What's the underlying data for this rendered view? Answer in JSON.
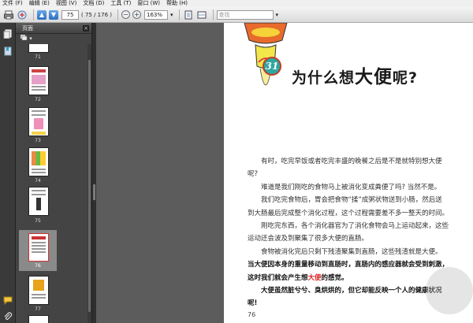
{
  "menu": [
    "文件 (F)",
    "编辑 (E)",
    "视图 (V)",
    "文档 (D)",
    "工具 (T)",
    "窗口 (W)",
    "帮助 (H)"
  ],
  "toolbar": {
    "page_current": "75",
    "page_total": "( 75 / 176 )",
    "zoom": "163%",
    "search_placeholder": "查找"
  },
  "panel": {
    "title": "页面",
    "close": "×",
    "options_label": "▾"
  },
  "thumbnails": [
    {
      "label": "71"
    },
    {
      "label": "72"
    },
    {
      "label": "73"
    },
    {
      "label": "74"
    },
    {
      "label": "75"
    },
    {
      "label": "76"
    },
    {
      "label": "77"
    }
  ],
  "page": {
    "chapter_number": "31",
    "title_pre": "为什么想",
    "title_big": "大便",
    "title_post": "呢?",
    "paragraphs": [
      "有时，吃完早饭或者吃完丰盛的晚餐之后是不是就特别想大便呢?",
      "难道是我们刚吃的食物马上被消化变成粪便了吗? 当然不是。",
      "我们吃完食物后，胃会把食物“揉”成粥状物送到小肠，然后送到大肠最后完成整个消化过程，这个过程需要差不多一整天的时间。",
      "刚吃完东西，各个消化器官为了消化食物会马上运动起来，这些运动还会波及到聚集了很多大便的直肠。"
    ],
    "para5_a": "食物被消化完后只剩下残渣聚集到直肠，这些残渣就是大便。",
    "para5_b": "当大便因本身的重量移动到直肠时，直肠内的感应器就会受到刺激，这时我们就会产生想",
    "para5_red": "大便",
    "para5_c": "的感觉。",
    "para6": "大便虽然脏兮兮、臭烘烘的，但它却能反映一个人的健康状况呢!",
    "page_number": "76"
  }
}
